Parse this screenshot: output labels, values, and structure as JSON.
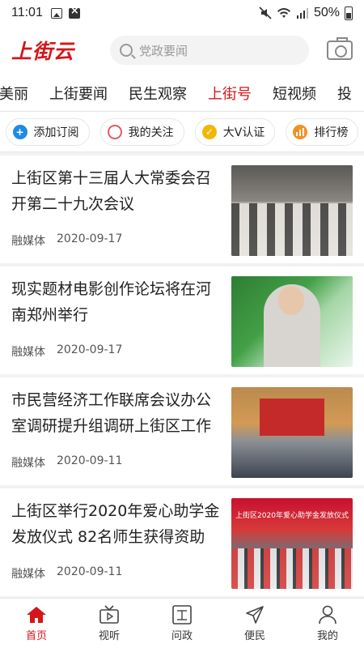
{
  "status_bar": {
    "time": "11:01",
    "battery": "50%"
  },
  "header": {
    "logo": "上街云",
    "search_placeholder": "党政要闻"
  },
  "tabs": [
    {
      "label": "美丽",
      "active": false
    },
    {
      "label": "上街要闻",
      "active": false
    },
    {
      "label": "民生观察",
      "active": false
    },
    {
      "label": "上街号",
      "active": true
    },
    {
      "label": "短视频",
      "active": false
    },
    {
      "label": "投",
      "active": false
    }
  ],
  "quick_actions": [
    {
      "label": "添加订阅",
      "icon": "plus-icon"
    },
    {
      "label": "我的关注",
      "icon": "ring-icon"
    },
    {
      "label": "大V认证",
      "icon": "v-badge-icon"
    },
    {
      "label": "排行榜",
      "icon": "bar-chart-icon"
    }
  ],
  "news": [
    {
      "title": "上街区第十三届人大常委会召开第二十九次会议",
      "source": "融媒体",
      "date": "2020-09-17"
    },
    {
      "title": "现实题材电影创作论坛将在河南郑州举行",
      "source": "融媒体",
      "date": "2020-09-17"
    },
    {
      "title": "市民营经济工作联席会议办公室调研提升组调研上街区工作",
      "source": "融媒体",
      "date": "2020-09-11"
    },
    {
      "title": "上街区举行2020年爱心助学金发放仪式 82名师生获得资助",
      "source": "融媒体",
      "date": "2020-09-11",
      "image_caption": "上街区2020年爱心助学金发放仪式"
    }
  ],
  "bottom_nav": [
    {
      "label": "首页",
      "icon": "home-icon",
      "active": true
    },
    {
      "label": "视听",
      "icon": "tv-icon",
      "active": false
    },
    {
      "label": "问政",
      "icon": "zheng-icon",
      "active": false
    },
    {
      "label": "便民",
      "icon": "send-icon",
      "active": false
    },
    {
      "label": "我的",
      "icon": "user-icon",
      "active": false
    }
  ],
  "colors": {
    "accent": "#d4161a",
    "plus": "#1f8ae6",
    "ring": "#e05b63",
    "vee": "#f2b705",
    "bars": "#f29123"
  }
}
